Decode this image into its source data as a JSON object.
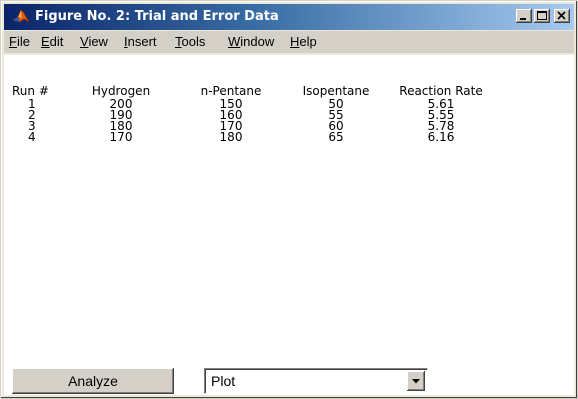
{
  "window": {
    "title": "Figure No. 2: Trial and Error Data",
    "icon": "matlab-logo-icon",
    "controls": [
      "minimize-icon",
      "maximize-icon",
      "close-icon"
    ]
  },
  "menu": {
    "items": [
      {
        "mnemonic": "F",
        "rest": "ile"
      },
      {
        "mnemonic": "E",
        "rest": "dit"
      },
      {
        "mnemonic": "V",
        "rest": "iew"
      },
      {
        "mnemonic": "I",
        "rest": "nsert"
      },
      {
        "mnemonic": "T",
        "rest": "ools"
      },
      {
        "mnemonic": "W",
        "rest": "indow"
      },
      {
        "mnemonic": "H",
        "rest": "elp"
      }
    ]
  },
  "table": {
    "headers": {
      "run": "Run #",
      "hydrogen": "Hydrogen",
      "npentane": "n-Pentane",
      "isopentane": "Isopentane",
      "rate": "Reaction Rate"
    },
    "rows": [
      {
        "run": "1",
        "hydrogen": "200",
        "npentane": "150",
        "isopentane": "50",
        "rate": "5.61"
      },
      {
        "run": "2",
        "hydrogen": "190",
        "npentane": "160",
        "isopentane": "55",
        "rate": "5.55"
      },
      {
        "run": "3",
        "hydrogen": "180",
        "npentane": "170",
        "isopentane": "60",
        "rate": "5.78"
      },
      {
        "run": "4",
        "hydrogen": "170",
        "npentane": "180",
        "isopentane": "65",
        "rate": "6.16"
      }
    ]
  },
  "controls": {
    "analyze_label": "Analyze",
    "plot_selected": "Plot",
    "dropdown_icon": "chevron-down-icon"
  },
  "colors": {
    "title_bar_start": "#0a246a",
    "title_bar_end": "#a6caf0",
    "chrome": "#d4d0c8",
    "figure_background": "#ffffff"
  }
}
